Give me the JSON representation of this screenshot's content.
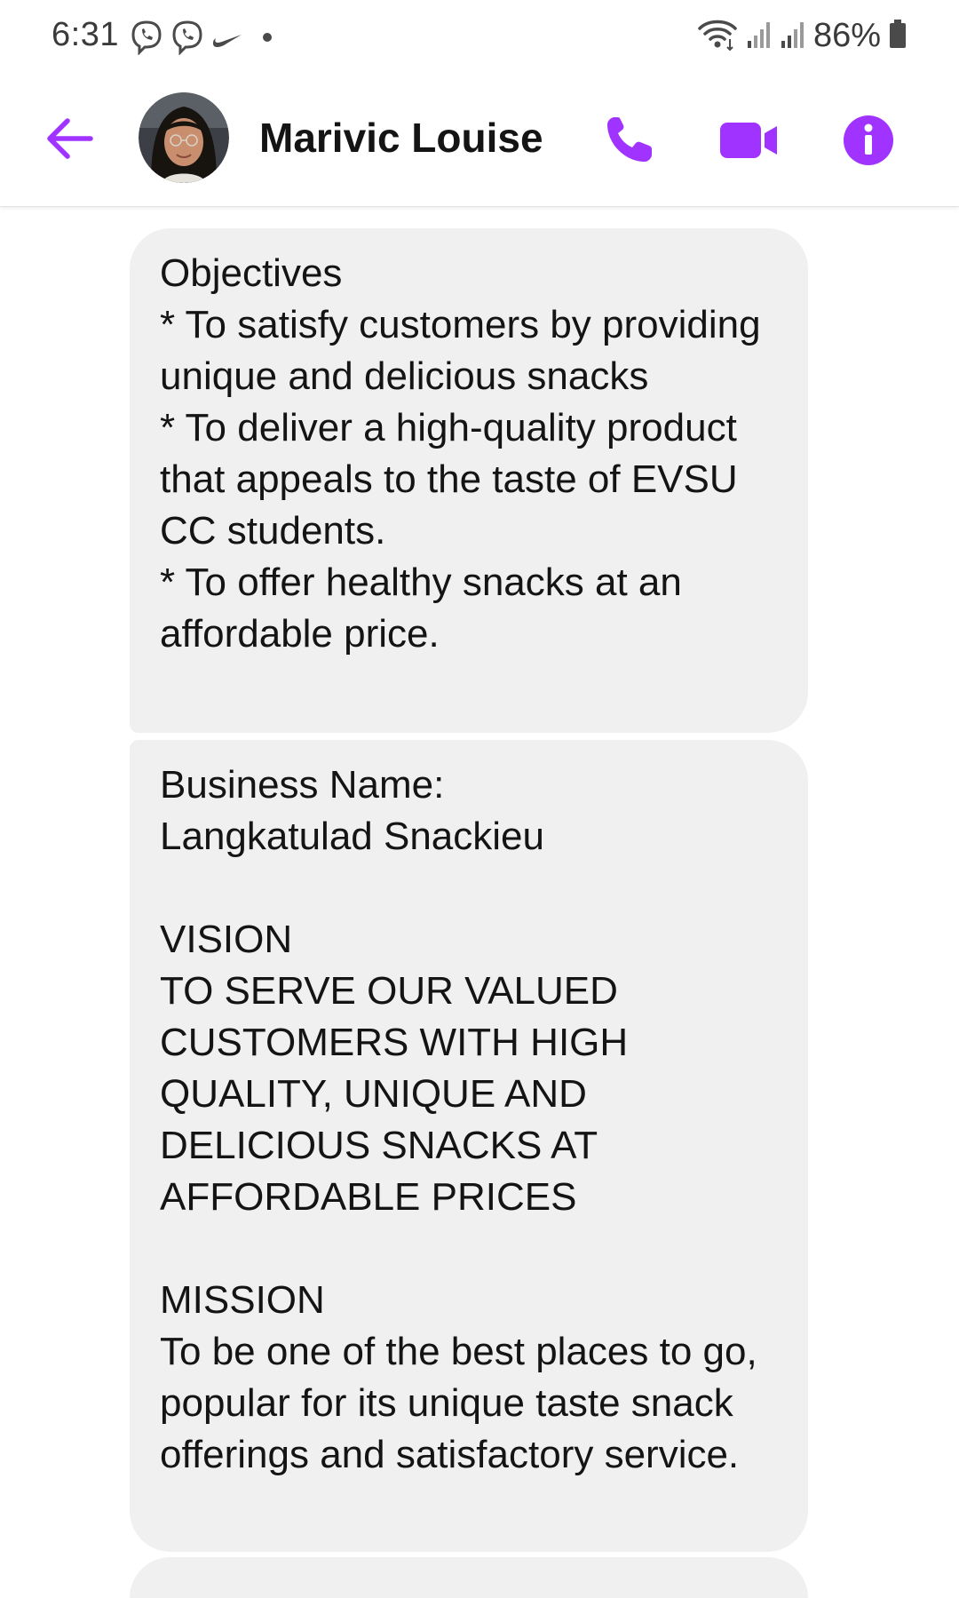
{
  "status_bar": {
    "time": "6:31",
    "battery": "86%",
    "left_icons": [
      "viber-icon",
      "viber-icon",
      "nike-icon",
      "dot-icon"
    ],
    "right_icons": [
      "wifi-icon",
      "signal-icon",
      "signal-icon",
      "battery-icon"
    ]
  },
  "header": {
    "contact_name": "Marivic Louise",
    "accent_color": "#a033ff"
  },
  "messages": [
    {
      "text": "Objectives\n* To satisfy customers by providing unique and delicious snacks\n* To deliver a high-quality product that appeals to the taste of EVSU CC students.\n* To offer healthy snacks at an affordable price."
    },
    {
      "text": "Business Name:\nLangkatulad Snackieu\n\nVISION\nTO SERVE OUR VALUED CUSTOMERS WITH HIGH QUALITY, UNIQUE AND DELICIOUS SNACKS AT AFFORDABLE PRICES\n\nMISSION\nTo be one of the best places to go, popular for its unique taste snack offerings and satisfactory service."
    }
  ]
}
